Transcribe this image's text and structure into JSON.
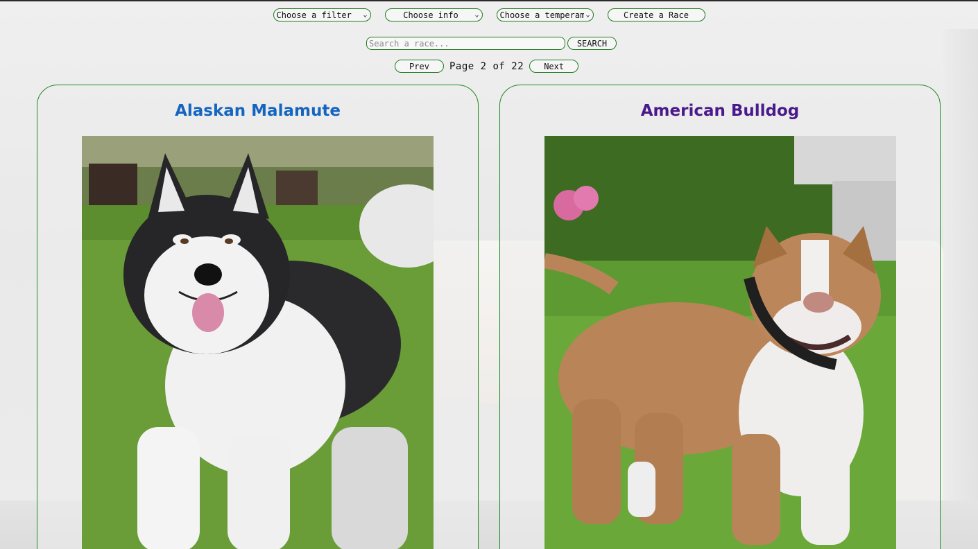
{
  "filters": {
    "filter_select": "Choose a filter",
    "info_select": "Choose info",
    "temperament_select": "Choose a temperament",
    "create_button": "Create a Race"
  },
  "search": {
    "placeholder": "Search a race...",
    "button_label": "SEARCH"
  },
  "pagination": {
    "prev_label": "Prev",
    "page_text": "Page 2 of 22",
    "next_label": "Next"
  },
  "cards": [
    {
      "name": "Alaskan Malamute",
      "title_color": "#1565c0",
      "image_alt": "alaskan-malamute-photo"
    },
    {
      "name": "American Bulldog",
      "title_color": "#4a1a8c",
      "image_alt": "american-bulldog-photo"
    }
  ],
  "colors": {
    "accent_border": "#1f7a1f"
  }
}
